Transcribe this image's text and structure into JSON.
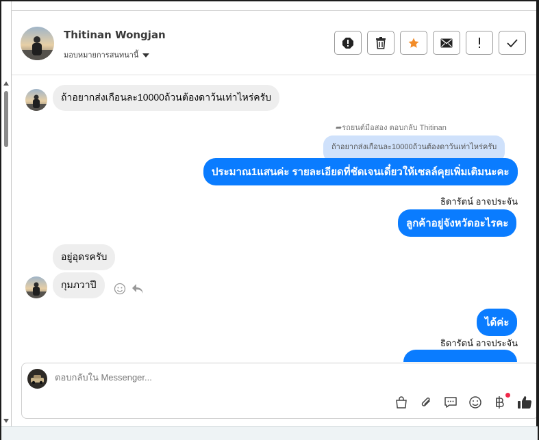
{
  "contact": {
    "name": "Thitinan Wongjan",
    "assign_label": "มอบหมายการสนทนานี้"
  },
  "actions": [
    {
      "id": "spam",
      "icon": "alert-circle-icon"
    },
    {
      "id": "delete",
      "icon": "trash-icon"
    },
    {
      "id": "star",
      "icon": "star-icon"
    },
    {
      "id": "unread",
      "icon": "envelope-icon"
    },
    {
      "id": "important",
      "icon": "exclamation-icon"
    },
    {
      "id": "done",
      "icon": "check-icon"
    }
  ],
  "colors": {
    "outgoing": "#0a7cff",
    "incoming": "#eeeeee",
    "quoted": "#cfe1fb",
    "star": "#f28c28"
  },
  "messages": {
    "m1": "ถ้าอยากส่งเกือนละ10000ถ้วนต้องดาว้นเท่าไหร่ครับ",
    "reply_note": "รถยนต์มือสอง ตอบกลับ Thitinan",
    "quoted": "ถ้าอยากส่งเกือนละ10000ถ้วนต้องดาว้นเท่าไหร่ครับ",
    "m2": "ประมาณ1แสนค่ะ รายละเอียดที่ชัดเจนเดี๋ยวให้เซลล์คุยเพิ่มเติมนะคะ",
    "sender1": "ธิดารัตน์ อาจประจัน",
    "m3": "ลูกค้าอยู่จังหวัดอะไรคะ",
    "m4": "อยู่อุดรครับ",
    "m5": "กุมภวาปี",
    "m6": "ได้ค่ะ",
    "sender2": "ธิดารัตน์ อาจประจัน"
  },
  "composer": {
    "placeholder": "ตอบกลับใน Messenger..."
  },
  "tools": [
    "bag-icon",
    "paperclip-icon",
    "chat-bubble-icon",
    "emoji-icon",
    "baht-icon",
    "thumbs-up-icon"
  ]
}
